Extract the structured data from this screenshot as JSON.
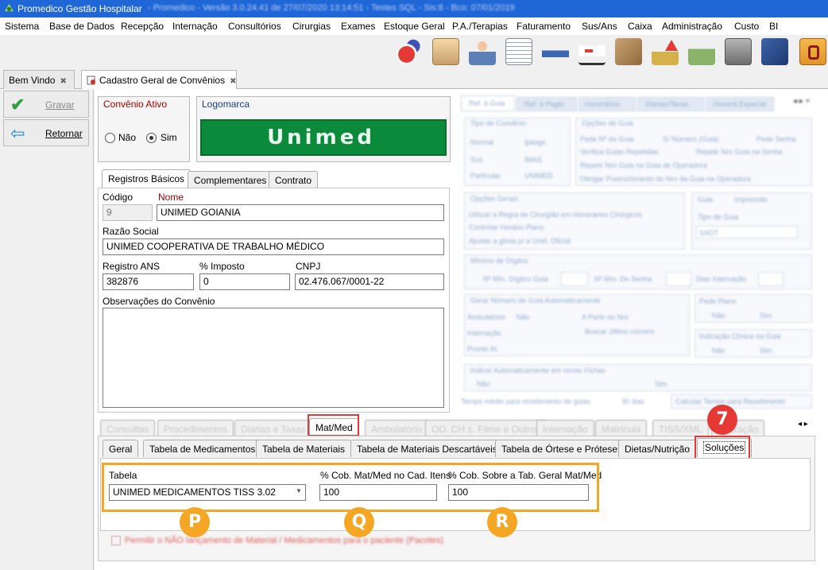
{
  "window": {
    "title": "Promedico Gestão Hospitalar",
    "subtitle_blurred": "- Promedico - Versão 3.0.24.41 de 27/07/2020 13:14:51 - Testes SQL - Sis:8 - Bco: 07/01/2019"
  },
  "menu": [
    "Sistema",
    "Base de Dados",
    "Recepção",
    "Internação",
    "Consultórios",
    "Cirurgias",
    "Exames",
    "Estoque Geral",
    "P.A./Terapias",
    "Faturamento",
    "Sus/Ans",
    "Caixa",
    "Administração",
    "Custo",
    "BI"
  ],
  "toolbar_icons": [
    "reload-icon",
    "users-icon",
    "doctor-icon",
    "notes-icon",
    "bed-icon",
    "ambulance-icon",
    "box-icon",
    "money-up-icon",
    "money-down-icon",
    "safe-icon",
    "card-icon",
    "phone-book-icon"
  ],
  "doc_tabs": [
    {
      "label": "Bem Vindo"
    },
    {
      "label": "Cadastro Geral de Convênios"
    }
  ],
  "left_buttons": {
    "save": "Gravar",
    "back": "Retornar"
  },
  "convenio_ativo": {
    "title": "Convênio Ativo",
    "no": "Não",
    "yes": "Sim",
    "selected": "yes"
  },
  "logomarca": {
    "title": "Logomarca",
    "logo_text": "Unimed"
  },
  "basic_tabs": [
    "Registros Básicos",
    "Complementares",
    "Contrato"
  ],
  "form": {
    "codigo_label": "Código",
    "codigo": "9",
    "nome_label": "Nome",
    "nome": "UNIMED GOIANIA",
    "razao_label": "Razão Social",
    "razao": "UNIMED COOPERATIVA DE TRABALHO MÉDICO",
    "ans_label": "Registro ANS",
    "ans": "382876",
    "imposto_label": "% Imposto",
    "imposto": "0",
    "cnpj_label": "CNPJ",
    "cnpj": "02.476.067/0001-22",
    "obs_label": "Observações do Convênio",
    "obs": ""
  },
  "lower_tabs": [
    "Consultas",
    "Procedimentos",
    "Diárias e Taxas",
    "Mat/Med",
    "Ambulatório",
    "OD. CH s. Filme e Outros",
    "Internação",
    "Matrícula",
    "TISS/XML",
    "Apuração"
  ],
  "matmed_tabs": [
    "Geral",
    "Tabela de Medicamentos",
    "Tabela de Materiais",
    "Tabela de Materiais Descartáveis",
    "Tabela de Órtese e Prótese",
    "Dietas/Nutrição",
    "Soluções"
  ],
  "solucoes": {
    "tabela_label": "Tabela",
    "tabela": "UNIMED MEDICAMENTOS TISS 3.02",
    "cob_label": "% Cob. Mat/Med no Cad. Itens",
    "cob": "100",
    "cob_geral_label": "% Cob. Sobre a Tab. Geral Mat/Med",
    "cob_geral": "100"
  },
  "footer_check": "Permitir o NÃO lançamento de Material / Medicamentos para o paciente (Pacotes)",
  "badges": {
    "seven": "7",
    "p": "P",
    "q": "Q",
    "r": "R"
  },
  "right_panel": {
    "tabs": [
      "Ref. à Guia",
      "Ref. à Pagto",
      "Honorários",
      "Diárias/Taxas",
      "Honorá Especial"
    ],
    "tipo_convenio": "Tipo de Convênio",
    "opcoes_guia": "Opções de Guia",
    "tipos": [
      "Normal",
      "Ipasgo",
      "Sus",
      "IMAS",
      "Particular",
      "UNIMED"
    ],
    "guia_opts": [
      "Pede Nº da Guia",
      "S/ Número (Guia)",
      "Pede Senha",
      "Verifica Guias Repetidas",
      "Repetir Nro Guia na Senha",
      "Repetir Nro Guia na Guia de Operadora",
      "Obrigar Preenchimento do Nro da Guia na Operadora"
    ],
    "opcoes_gerais": "Opções Gerais",
    "gerais": [
      "Utilizar a Regra de Cirurgião em Honorários Cirúrgicos",
      "Controlar Horário Plano",
      "Ajustar a glosa p/ a Unid. Oficial"
    ],
    "sub_tabs": [
      "Guia",
      "Impressão"
    ],
    "tipo_guia": "Tipo de Guia",
    "tipo_guia_val": "SADT",
    "digitos": "Mínimo de Dígitos",
    "dig_guia": "Nº Mín. Dígitos Guia",
    "dig_senha": "Nº Mín. Do Senha",
    "dias_int": "Dias Internação",
    "gerar": "Gerar Número de Guia Automaticamente",
    "amb": "Ambulatório",
    "amb_val": "Não",
    "a_partir": "A Partir do Nro",
    "int": "Internação",
    "pronto": "Pronto At.",
    "buscar": "Buscar último número",
    "pede_plano": "Pede Plano",
    "ind_clinica": "Indicação Clínica na Guia",
    "nao": "Não",
    "sim": "Sim",
    "indicar": "Indicar Automaticamente em novas Fichas",
    "tempo": "Tempo médio para recebimento de guias",
    "tempo_val": "30 dias",
    "calcular": "Calcular Tempo para Recebimento"
  }
}
